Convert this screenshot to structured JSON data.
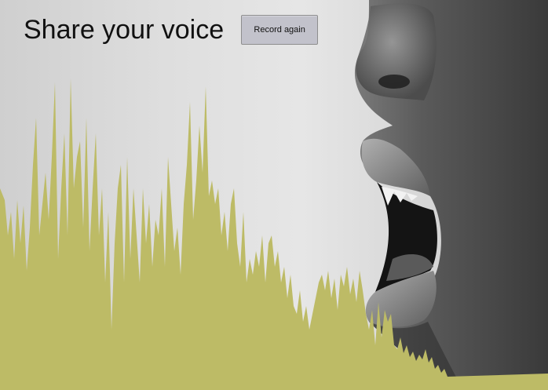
{
  "page": {
    "title": "Share your voice",
    "record_button_label": "Record again"
  },
  "colors": {
    "waveform": "#bdbb66",
    "background": "#e0e0e0",
    "button_bg": "#c2c2cb"
  },
  "icons": {
    "hero_image": "profile-of-open-mouth-photo",
    "waveform": "audio-waveform"
  }
}
